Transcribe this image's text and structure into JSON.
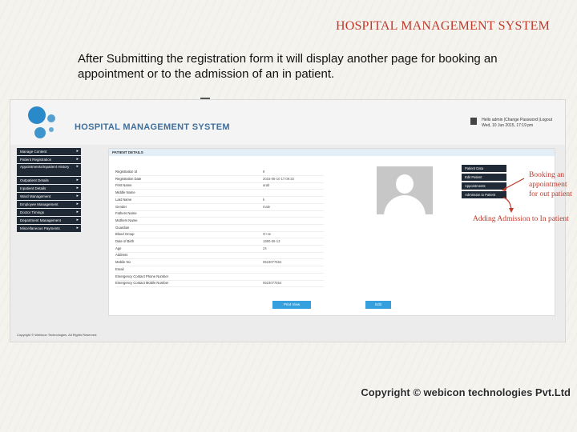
{
  "slide": {
    "title": "HOSPITAL MANAGEMENT SYSTEM",
    "intro": "After Submitting the registration form it will display another page for booking  an appointment or to the admission of an in patient.",
    "copyright": "Copyright © webicon technologies Pvt.Ltd"
  },
  "app": {
    "title": "HOSPITAL MANAGEMENT SYSTEM",
    "user_line1": "Hello admin  |Change Password |Logout",
    "user_line2": "Wed, 10 Jun 2015, 17:19 pm",
    "footer": "Copyright © Webicon Technologies. All Rights Reserved."
  },
  "nav": {
    "items": [
      {
        "label": "Manage Content"
      },
      {
        "label": "Patient Registration"
      },
      {
        "label": "Appointments/Inpatient History"
      },
      {
        "label": "Outpatient Details"
      },
      {
        "label": "Inpatient Details"
      },
      {
        "label": "Ward Management"
      },
      {
        "label": "Employee Management"
      },
      {
        "label": "Doctor Timings"
      },
      {
        "label": "Department Management"
      },
      {
        "label": "Miscellaneous Payments"
      }
    ]
  },
  "patient": {
    "heading": "PATIENT DETAILS",
    "fields": [
      {
        "label": "Registration Id",
        "value": "8"
      },
      {
        "label": "Registration Date",
        "value": "2015-06-10 17:09:33"
      },
      {
        "label": "First Name",
        "value": "arab"
      },
      {
        "label": "Middle Name",
        "value": ""
      },
      {
        "label": "Last Name",
        "value": "k"
      },
      {
        "label": "Gender",
        "value": "male"
      },
      {
        "label": "Fathers Name",
        "value": ""
      },
      {
        "label": "Mothers Name",
        "value": ""
      },
      {
        "label": "Guardian",
        "value": ""
      },
      {
        "label": "Blood Group",
        "value": "O+ve"
      },
      {
        "label": "Date of Birth",
        "value": "1990-05-13"
      },
      {
        "label": "Age",
        "value": "24"
      },
      {
        "label": "Address",
        "value": ""
      },
      {
        "label": "Mobile No",
        "value": "0623077654"
      },
      {
        "label": "Email",
        "value": ""
      },
      {
        "label": "Emergency Contact Phone Number",
        "value": ""
      },
      {
        "label": "Emergency Contact Mobile Number",
        "value": "0623077654"
      }
    ],
    "print_view_label": "Print View",
    "edit_label": "Edit"
  },
  "patient_menu": {
    "items": [
      {
        "label": "Patient Data"
      },
      {
        "label": "Edit Patient"
      },
      {
        "label": "Appointments"
      },
      {
        "label": "Admission to Patient"
      }
    ]
  },
  "annotations": {
    "booking": "Booking an appointment for out patient",
    "adding": "Adding Admission to In patient",
    "color": "#c0392b"
  }
}
